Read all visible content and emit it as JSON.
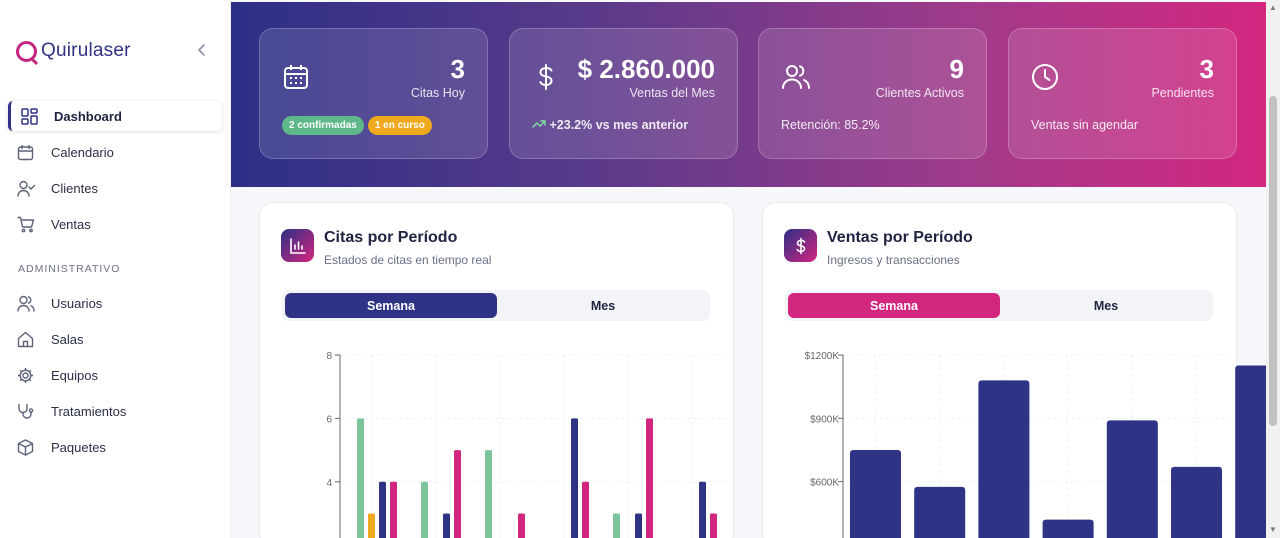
{
  "app": {
    "name": "Quirulaser"
  },
  "sidebar": {
    "items": [
      {
        "label": "Dashboard",
        "icon": "dashboard-icon"
      },
      {
        "label": "Calendario",
        "icon": "calendar-icon"
      },
      {
        "label": "Clientes",
        "icon": "user-check-icon"
      },
      {
        "label": "Ventas",
        "icon": "cart-icon"
      }
    ],
    "section_label": "ADMINISTRATIVO",
    "admin_items": [
      {
        "label": "Usuarios",
        "icon": "users-icon"
      },
      {
        "label": "Salas",
        "icon": "home-icon"
      },
      {
        "label": "Equipos",
        "icon": "gear-icon"
      },
      {
        "label": "Tratamientos",
        "icon": "stethoscope-icon"
      },
      {
        "label": "Paquetes",
        "icon": "package-icon"
      }
    ]
  },
  "stats": [
    {
      "value": "3",
      "label": "Citas Hoy",
      "badges": [
        "2 confirmadas",
        "1 en curso"
      ],
      "icon": "calendar-icon"
    },
    {
      "value": "$ 2.860.000",
      "label": "Ventas del Mes",
      "footer": "+23.2% vs mes anterior",
      "icon": "dollar-icon"
    },
    {
      "value": "9",
      "label": "Clientes Activos",
      "footer": "Retención: 85.2%",
      "icon": "users-icon"
    },
    {
      "value": "3",
      "label": "Pendientes",
      "footer": "Ventas sin agendar",
      "icon": "clock-icon"
    }
  ],
  "cards": {
    "citas": {
      "title": "Citas por Período",
      "subtitle": "Estados de citas en tiempo real",
      "tabs": [
        "Semana",
        "Mes"
      ],
      "icon": "bar-chart-icon"
    },
    "ventas": {
      "title": "Ventas por Período",
      "subtitle": "Ingresos y transacciones",
      "tabs": [
        "Semana",
        "Mes"
      ],
      "icon": "dollar-icon"
    }
  },
  "colors": {
    "navy": "#2f3385",
    "magenta": "#d3267f",
    "green": "#7dc49b",
    "yellow": "#f0a91c"
  },
  "chart_data": [
    {
      "type": "bar",
      "visible_ylim": [
        2.3,
        8
      ],
      "yticks": [
        4,
        6,
        8
      ],
      "groups": [
        {
          "green": 6,
          "yellow": 3,
          "navy": 4,
          "magenta": 4
        },
        {
          "green": 4,
          "yellow": 0,
          "navy": 3,
          "magenta": 5
        },
        {
          "green": 5,
          "yellow": 0,
          "navy": 0,
          "magenta": 3
        },
        {
          "green": 0,
          "yellow": 0,
          "navy": 6,
          "magenta": 4
        },
        {
          "green": 3,
          "yellow": 0,
          "navy": 3,
          "magenta": 6
        },
        {
          "green": 0,
          "yellow": 0,
          "navy": 4,
          "magenta": 3
        }
      ]
    },
    {
      "type": "bar",
      "visible_ylim": [
        400000,
        1200000
      ],
      "yticks": [
        600000,
        900000,
        1200000
      ],
      "ytick_labels": [
        "$600K",
        "$900K",
        "$1200K"
      ],
      "values": [
        750000,
        575000,
        1080000,
        420000,
        890000,
        670000,
        1150000
      ]
    }
  ]
}
